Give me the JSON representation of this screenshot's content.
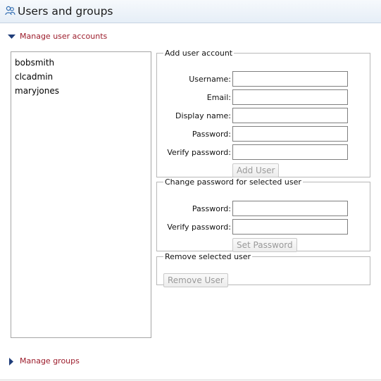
{
  "header": {
    "title": "Users and groups",
    "icon": "users-icon"
  },
  "sections": {
    "manage_users": {
      "label": "Manage user accounts",
      "expanded": true
    },
    "manage_groups": {
      "label": "Manage groups",
      "expanded": false
    }
  },
  "users": [
    "bobsmith",
    "clcadmin",
    "maryjones"
  ],
  "add_user": {
    "legend": "Add user account",
    "username_label": "Username:",
    "email_label": "Email:",
    "display_name_label": "Display name:",
    "password_label": "Password:",
    "verify_label": "Verify password:",
    "username_value": "",
    "email_value": "",
    "display_name_value": "",
    "password_value": "",
    "verify_value": "",
    "button": "Add User"
  },
  "change_password": {
    "legend": "Change password for selected user",
    "password_label": "Password:",
    "verify_label": "Verify password:",
    "password_value": "",
    "verify_value": "",
    "button": "Set Password"
  },
  "remove_user": {
    "legend": "Remove selected user",
    "button": "Remove User"
  },
  "colors": {
    "accent_link": "#9c1c2b",
    "arrow": "#1f3d7a",
    "header_bg": "#e6eef7",
    "disabled_text": "#9a9a9a"
  }
}
